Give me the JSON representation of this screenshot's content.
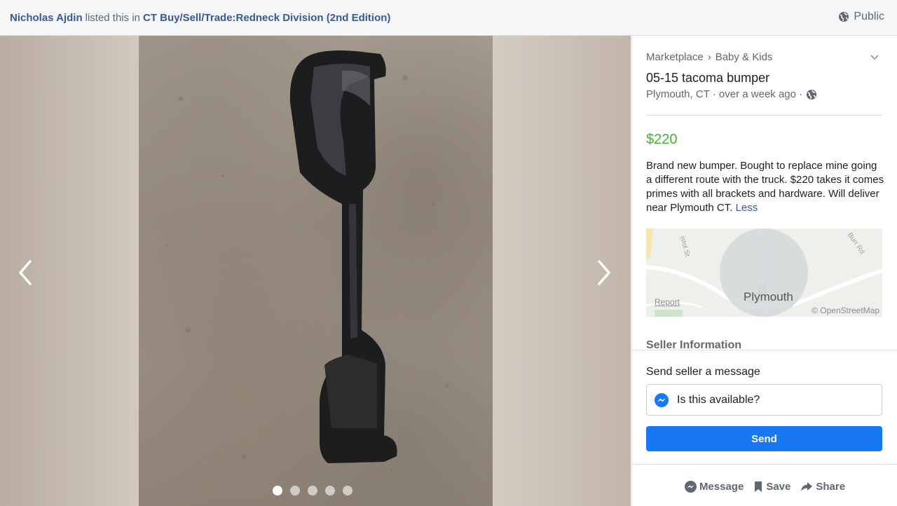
{
  "header": {
    "poster_name": "Nicholas Ajdin",
    "listed_text": "listed this in",
    "group_name": "CT Buy/Sell/Trade:Redneck Division (2nd Edition)",
    "visibility": "Public"
  },
  "viewer": {
    "dots_count": 5,
    "active_dot": 0
  },
  "listing": {
    "breadcrumb_root": "Marketplace",
    "breadcrumb_sep": "›",
    "breadcrumb_category": "Baby & Kids",
    "title": "05-15 tacoma bumper",
    "location_time": "Plymouth, CT · over a week ago ·",
    "price": "$220",
    "description": "Brand new bumper. Bought to replace mine going a different route with the truck. $220 takes it comes primes with all brackets and hardware. Will deliver near Plymouth CT.",
    "less_link": "Less"
  },
  "map": {
    "place": "Plymouth",
    "report": "Report",
    "attribution": "© OpenStreetMap",
    "street1": "istol St",
    "street2": "Burr Rd"
  },
  "seller": {
    "section_title": "Seller Information",
    "send_label": "Send seller a message",
    "message_value": "Is this available?",
    "send_button": "Send"
  },
  "footer": {
    "message": "Message",
    "save": "Save",
    "share": "Share"
  },
  "colors": {
    "link": "#385898",
    "price": "#42b72a",
    "primary_button": "#1877f2"
  }
}
